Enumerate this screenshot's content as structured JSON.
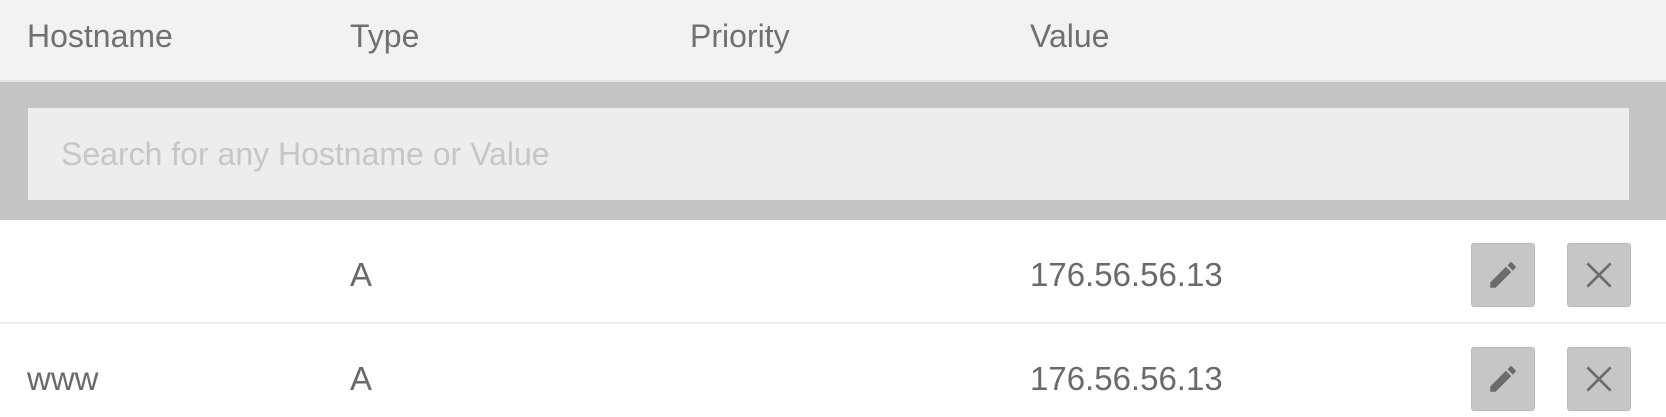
{
  "table": {
    "columns": {
      "hostname": "Hostname",
      "type": "Type",
      "priority": "Priority",
      "value": "Value"
    },
    "search": {
      "placeholder": "Search for any Hostname or Value",
      "value": ""
    },
    "rows": [
      {
        "hostname": "",
        "type": "A",
        "priority": "",
        "value": "176.56.56.13",
        "edit_icon": "pencil-icon",
        "delete_icon": "close-icon"
      },
      {
        "hostname": "www",
        "type": "A",
        "priority": "",
        "value": "176.56.56.13",
        "edit_icon": "pencil-icon",
        "delete_icon": "close-icon"
      }
    ]
  },
  "colors": {
    "header_bg": "#f2f2f2",
    "search_band_bg": "#c4c4c4",
    "search_input_bg": "#ededed",
    "button_bg": "#c6c6c6",
    "icon_color": "#6b6b6b",
    "text": "#6e6e6e"
  }
}
